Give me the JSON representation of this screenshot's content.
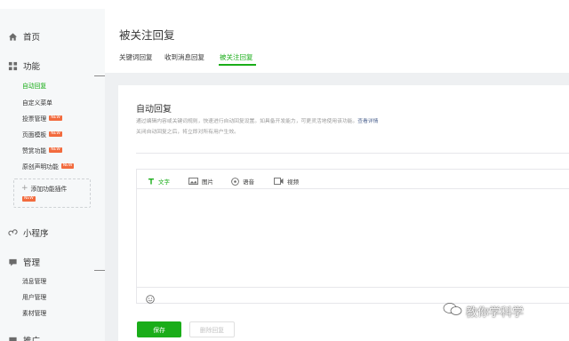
{
  "sidebar": {
    "home": "首页",
    "features": "功能",
    "feature_items": [
      {
        "label": "自动回复",
        "new": false,
        "active": true
      },
      {
        "label": "自定义菜单",
        "new": false,
        "active": false
      },
      {
        "label": "投票管理",
        "new": true,
        "active": false
      },
      {
        "label": "页面模板",
        "new": true,
        "active": false
      },
      {
        "label": "赞赏功能",
        "new": true,
        "active": false
      },
      {
        "label": "原创声明功能",
        "new": true,
        "active": false
      }
    ],
    "add_plugin": "添加功能插件",
    "mini_program": "小程序",
    "management": "管理",
    "management_items": [
      "消息管理",
      "用户管理",
      "素材管理"
    ],
    "next_section": "推广",
    "new_badge": "NEW"
  },
  "page": {
    "title": "被关注回复",
    "tabs": [
      "关键词回复",
      "收到消息回复",
      "被关注回复"
    ],
    "active_tab": 2
  },
  "card": {
    "title": "自动回复",
    "desc_line1": "通过编辑内容或关键词规则，快速进行自动回复设置。如具备开发能力，可更灵活地使用该功能。",
    "desc_link": "查看详情",
    "desc_line2": "关闭自动回复之后，将立即对所有用户生效。"
  },
  "editor": {
    "tools": [
      {
        "label": "文字",
        "icon": "text-icon",
        "active": true
      },
      {
        "label": "图片",
        "icon": "image-icon",
        "active": false
      },
      {
        "label": "语音",
        "icon": "voice-icon",
        "active": false
      },
      {
        "label": "视频",
        "icon": "video-icon",
        "active": false
      }
    ]
  },
  "buttons": {
    "save": "保存",
    "delete": "删除回复"
  },
  "watermark": "教你学科学",
  "colors": {
    "accent": "#1aad19",
    "new_badge": "#f26b3e",
    "link": "#576b95",
    "sidebar_bg": "#f6f8f9"
  }
}
